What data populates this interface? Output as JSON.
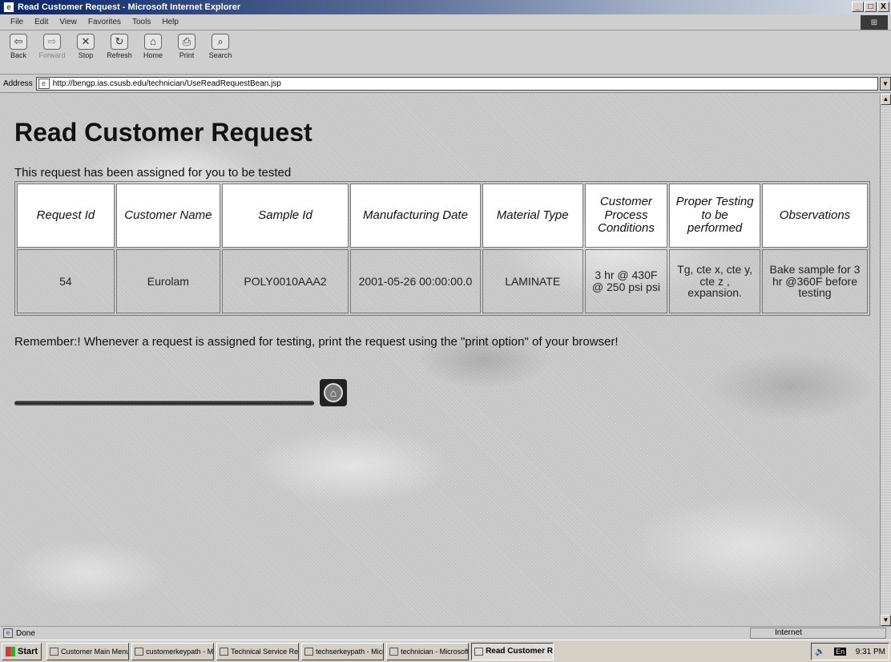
{
  "window": {
    "title": "Read Customer Request - Microsoft Internet Explorer",
    "buttons": {
      "minimize": "_",
      "maximize": "□",
      "close": "X"
    }
  },
  "menu": [
    "File",
    "Edit",
    "View",
    "Favorites",
    "Tools",
    "Help"
  ],
  "toolbar": {
    "back": "Back",
    "forward": "Forward",
    "stop": "Stop",
    "refresh": "Refresh",
    "home": "Home",
    "print": "Print",
    "search": "Search"
  },
  "address": {
    "label": "Address",
    "url": "http://bengp.ias.csusb.edu/technician/UseReadRequestBean.jsp"
  },
  "page": {
    "title": "Read Customer Request",
    "assigned_message": "This request has been assigned for you to be tested",
    "reminder": "Remember:! Whenever a request is assigned for testing, print the request using the \"print option\" of your browser!"
  },
  "table": {
    "headers": [
      "Request Id",
      "Customer Name",
      "Sample Id",
      "Manufacturing Date",
      "Material Type",
      "Customer Process Conditions",
      "Proper Testing to be performed",
      "Observations"
    ],
    "rows": [
      [
        "54",
        "Eurolam",
        "POLY0010AAA2",
        "2001-05-26 00:00:00.0",
        "LAMINATE",
        "3 hr @ 430F @ 250 psi psi",
        "Tg, cte x, cte y, cte z , expansion.",
        "Bake sample for 3 hr @360F before testing"
      ]
    ]
  },
  "status": {
    "text": "Done",
    "zone": "Internet"
  },
  "taskbar": {
    "start": "Start",
    "tasks": [
      "Customer Main Menu ...",
      "customerkeypath - Mi...",
      "Technical Service Re...",
      "techserkeypath - Micr...",
      "technician - Microsoft ...",
      "Read Customer R..."
    ],
    "language": "En",
    "time": "9:31 PM"
  }
}
